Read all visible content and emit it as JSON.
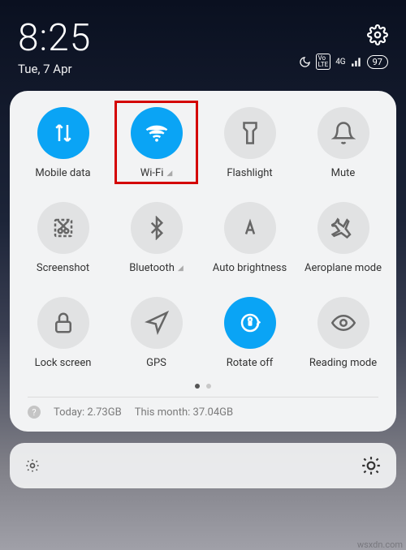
{
  "status": {
    "time": "8:25",
    "date": "Tue, 7 Apr",
    "battery": "97",
    "network": "4G"
  },
  "tiles": {
    "mobile_data": "Mobile data",
    "wifi": "Wi-Fi",
    "flashlight": "Flashlight",
    "mute": "Mute",
    "screenshot": "Screenshot",
    "bluetooth": "Bluetooth",
    "auto_brightness": "Auto brightness",
    "aeroplane": "Aeroplane mode",
    "lock_screen": "Lock screen",
    "gps": "GPS",
    "rotate": "Rotate off",
    "reading": "Reading mode"
  },
  "usage": {
    "today_label": "Today:",
    "today_value": "2.73GB",
    "month_label": "This month:",
    "month_value": "37.04GB"
  },
  "watermark": "wsxdn.com"
}
